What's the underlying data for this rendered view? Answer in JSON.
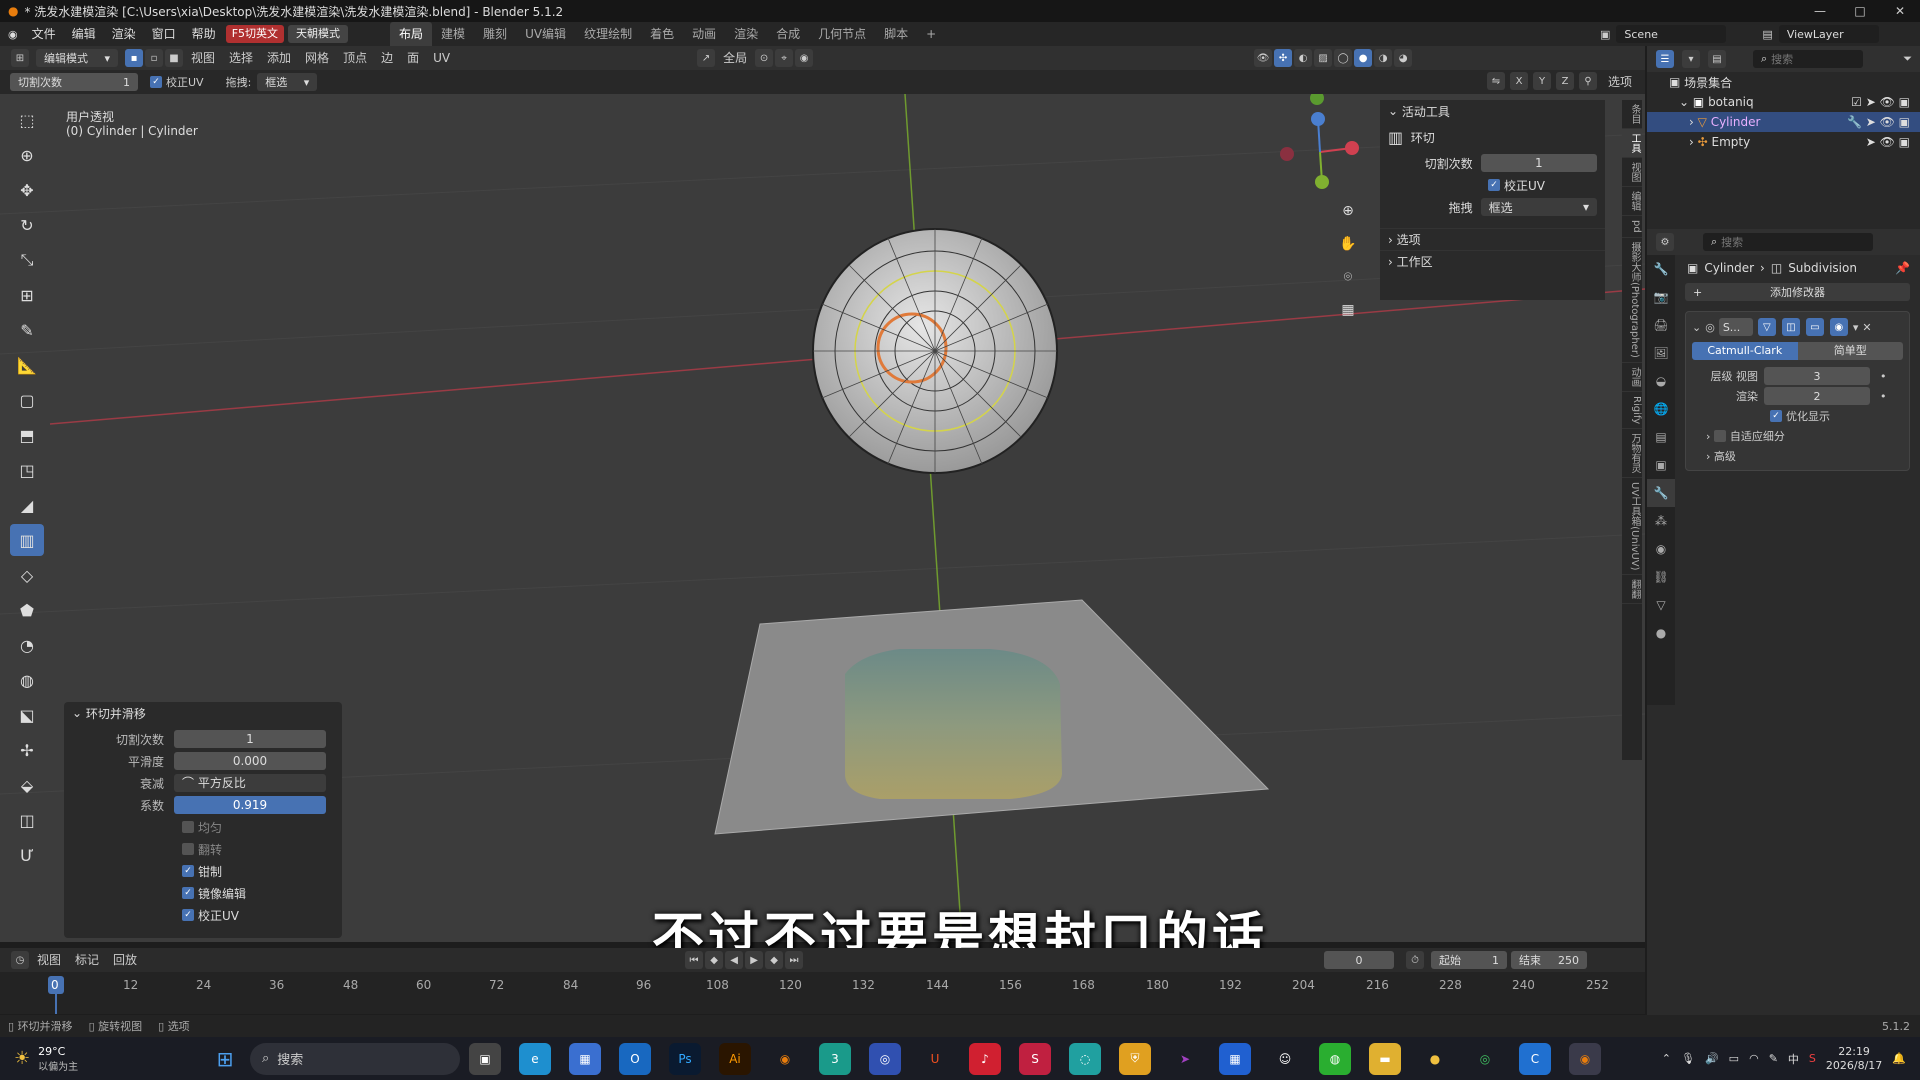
{
  "window": {
    "title": "* 洗发水建模渲染 [C:\\Users\\xia\\Desktop\\洗发水建模渲染\\洗发水建模渲染.blend] - Blender 5.1.2"
  },
  "menu": {
    "items": [
      "文件",
      "编辑",
      "渲染",
      "窗口",
      "帮助"
    ],
    "f5": "F5切英文",
    "sky": "天朝模式"
  },
  "workspaces": [
    "布局",
    "建模",
    "雕刻",
    "UV编辑",
    "纹理绘制",
    "着色",
    "动画",
    "渲染",
    "合成",
    "几何节点",
    "脚本"
  ],
  "scene": {
    "label": "Scene",
    "viewlayer": "ViewLayer"
  },
  "header": {
    "mode": "编辑模式",
    "menus": [
      "视图",
      "选择",
      "添加",
      "网格",
      "顶点",
      "边",
      "面",
      "UV"
    ],
    "transform": "全局",
    "options": "选项"
  },
  "tool_settings": {
    "cuts_label": "切割次数",
    "cuts_value": "1",
    "correct_uv": "校正UV",
    "drag_label": "拖拽:",
    "drag_value": "框选"
  },
  "viewport": {
    "view_name": "用户透视",
    "object_name": "(0) Cylinder | Cylinder"
  },
  "active_tool": {
    "title": "活动工具",
    "tool": "环切",
    "cuts_label": "切割次数",
    "cuts_value": "1",
    "correct_uv": "校正UV",
    "drag_label": "拖拽",
    "drag_value": "框选",
    "options": "选项",
    "workspace": "工作区"
  },
  "sidebar_tabs": [
    "条目",
    "工具",
    "视图",
    "编辑",
    "pd",
    "摄影大师(Photographer)",
    "动画",
    "Rigify",
    "万物有灵",
    "UV工具箱(UnivUV)",
    "翻翻"
  ],
  "outliner": {
    "collection": "场景集合",
    "items": [
      "botaniq",
      "Cylinder",
      "Empty"
    ],
    "search_placeholder": "搜索"
  },
  "properties": {
    "breadcrumb_obj": "Cylinder",
    "breadcrumb_mod": "Subdivision",
    "add_modifier": "添加修改器",
    "mod_short": "S...",
    "catmull": "Catmull-Clark",
    "simple": "简单型",
    "levels_label": "层级 视图",
    "levels_value": "3",
    "render_label": "渲染",
    "render_value": "2",
    "optimal": "优化显示",
    "adaptive": "自适应细分",
    "advanced": "高级",
    "search_placeholder": "搜索"
  },
  "operator": {
    "title": "环切并滑移",
    "rows": [
      {
        "label": "切割次数",
        "value": "1"
      },
      {
        "label": "平滑度",
        "value": "0.000"
      },
      {
        "label": "衰减",
        "value": "平方反比"
      },
      {
        "label": "系数",
        "value": "0.919"
      }
    ],
    "checks": [
      {
        "label": "均匀",
        "on": false
      },
      {
        "label": "翻转",
        "on": false
      },
      {
        "label": "钳制",
        "on": true
      },
      {
        "label": "镜像编辑",
        "on": true
      },
      {
        "label": "校正UV",
        "on": true
      }
    ]
  },
  "timeline": {
    "menus": [
      "视图",
      "标记",
      "回放"
    ],
    "current": "0",
    "start_label": "起始",
    "start": "1",
    "end_label": "结束",
    "end": "250",
    "frames": [
      "0",
      "12",
      "24",
      "36",
      "48",
      "60",
      "72",
      "84",
      "96",
      "108",
      "120",
      "132",
      "144",
      "156",
      "168",
      "180",
      "192",
      "204",
      "216",
      "228",
      "240",
      "252"
    ]
  },
  "status": {
    "items": [
      "环切并滑移",
      "旋转视图",
      "选项"
    ],
    "version": "5.1.2"
  },
  "subtitle": "不过不过要是想封口的话",
  "taskbar": {
    "weather": "29°C",
    "weather_sub": "以偏为主",
    "search": "搜索",
    "time": "22:19",
    "date": "2026/8/17",
    "lang": "中"
  }
}
